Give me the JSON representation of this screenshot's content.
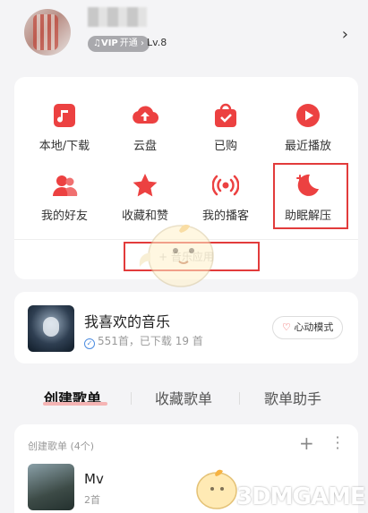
{
  "header": {
    "vip_mark": "♫VIP",
    "vip_label": "开通",
    "level": "Lv.8"
  },
  "grid": {
    "items": [
      {
        "label": "本地/下载",
        "icon": "music-file-icon"
      },
      {
        "label": "云盘",
        "icon": "cloud-upload-icon"
      },
      {
        "label": "已购",
        "icon": "shopping-bag-icon"
      },
      {
        "label": "最近播放",
        "icon": "play-circle-icon"
      },
      {
        "label": "我的好友",
        "icon": "friends-icon"
      },
      {
        "label": "收藏和赞",
        "icon": "star-icon"
      },
      {
        "label": "我的播客",
        "icon": "broadcast-icon"
      },
      {
        "label": "助眠解压",
        "icon": "moon-icon"
      }
    ],
    "music_apps": "+ 音乐应用"
  },
  "favorites": {
    "title": "我喜欢的音乐",
    "subtitle": "551首，已下载 19 首",
    "mode_button": "心动模式"
  },
  "tabs": [
    {
      "label": "创建歌单",
      "active": true
    },
    {
      "label": "收藏歌单",
      "active": false
    },
    {
      "label": "歌单助手",
      "active": false
    }
  ],
  "playlists": {
    "header": "创建歌单 (4个)",
    "items": [
      {
        "name": "Mv",
        "count": "2首"
      }
    ]
  },
  "watermark": "3DMGAME",
  "colors": {
    "accent": "#ec4141",
    "highlight_box": "#e23b3b"
  }
}
